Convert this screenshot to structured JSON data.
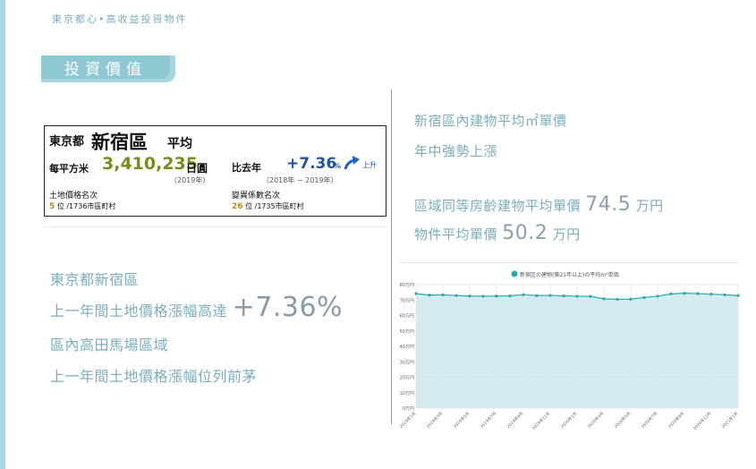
{
  "header": {
    "title": "東京都心•高收益投資物件"
  },
  "section_tag": "投資價值",
  "summary": {
    "city": "東京都",
    "district": "新宿區",
    "avg": "平均",
    "price_label": "每平方米",
    "price": "3,410,235",
    "price_unit": "日圓",
    "price_year": "（2019年）",
    "change_label": "比去年",
    "change_value": "+7.36",
    "change_pct": "%",
    "change_dir": "上升",
    "change_years": "（2018年 − 2019年）",
    "rank_label": "土地價格名次",
    "rank_num": "5",
    "rank_rest": "位 /1736市區町村",
    "vol_label": "變異係數名次",
    "vol_num": "26",
    "vol_rest": "位 /1735市區町村"
  },
  "left_text": {
    "line1": "東京都新宿區",
    "line2": "上一年間土地價格漲幅高達",
    "line2_big": "+7.36%",
    "line3": "區內高田馬場區域",
    "line4": "上一年間土地價格漲幅位列前茅"
  },
  "right_text": {
    "line1": "新宿區內建物平均㎡單價",
    "line2": "年中強勢上漲",
    "line3": "區域同等房齡建物平均單價",
    "line3_big": "74.5",
    "line3_unit": "万円",
    "line4": "物件平均單價",
    "line4_big": "50.2",
    "line4_unit": "万円"
  },
  "colors": {
    "accent": "#7aaebd",
    "line": "#2aa9ad",
    "area": "#cde9ee"
  },
  "chart_data": {
    "type": "area",
    "legend": "新宿区の建物(築21年以上)の平均m²単価",
    "legend_position": "top",
    "ylim": [
      0,
      80
    ],
    "yticks": [
      0,
      10,
      20,
      30,
      40,
      50,
      60,
      70,
      80
    ],
    "ytick_labels": [
      "0万円",
      "10万円",
      "20万円",
      "30万円",
      "40万円",
      "50万円",
      "60万円",
      "70万円",
      "80万円"
    ],
    "grid": true,
    "x": [
      "2019年1月",
      "2019年2月",
      "2019年3月",
      "2019年4月",
      "2019年5月",
      "2019年6月",
      "2019年7月",
      "2019年8月",
      "2019年9月",
      "2019年10月",
      "2019年11月",
      "2019年12月",
      "2020年1月",
      "2020年2月",
      "2020年3月",
      "2020年4月",
      "2020年5月",
      "2020年6月",
      "2020年7月",
      "2020年8月",
      "2020年9月",
      "2020年10月",
      "2020年11月",
      "2020年12月",
      "2021年1月"
    ],
    "xtick_labels": [
      "2019年1月",
      "2019年3月",
      "2019年5月",
      "2019年7月",
      "2019年9月",
      "2019年11月",
      "2020年1月",
      "2020年3月",
      "2020年5月",
      "2020年7月",
      "2020年9月",
      "2020年11月",
      "2021年1月"
    ],
    "series": [
      {
        "values": [
          74.2,
          73.2,
          73.4,
          72.9,
          72.6,
          72.5,
          72.6,
          72.7,
          73.5,
          72.9,
          73.0,
          72.7,
          72.5,
          72.4,
          70.8,
          70.5,
          70.6,
          71.7,
          72.5,
          74.0,
          74.4,
          74.2,
          73.8,
          73.4,
          72.9
        ]
      }
    ]
  }
}
